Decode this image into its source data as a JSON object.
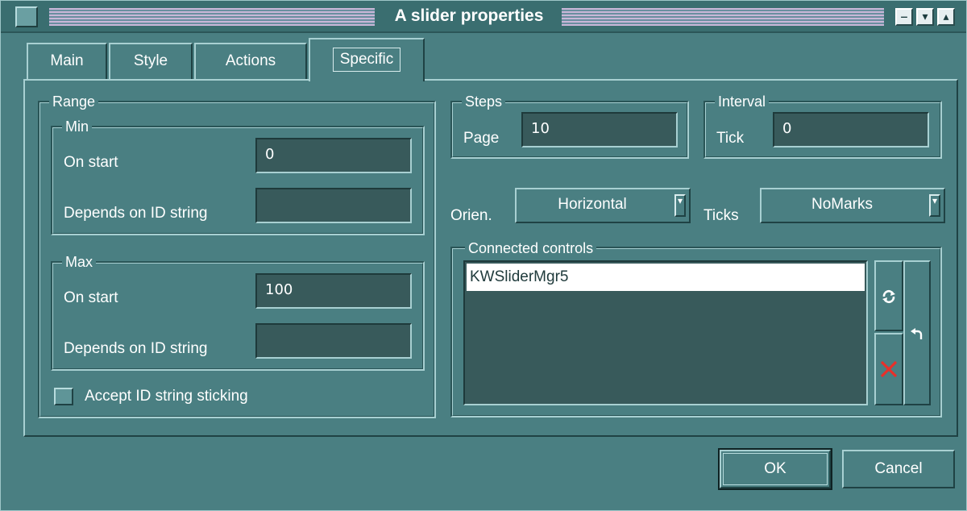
{
  "window": {
    "title": "A slider properties",
    "controls": {
      "minimize": "‒",
      "shade": "▾",
      "maximize": "▴"
    }
  },
  "tabs": [
    {
      "label": "Main",
      "mnemonic": "M"
    },
    {
      "label": "Style",
      "mnemonic": "S"
    },
    {
      "label": "Actions",
      "mnemonic": "A"
    },
    {
      "label": "Specific",
      "mnemonic": "p",
      "active": true
    }
  ],
  "range": {
    "legend": "Range",
    "min": {
      "legend": "Min",
      "on_start_label": "On start",
      "on_start_value": "0",
      "depends_label": "Depends on ID string",
      "depends_value": ""
    },
    "max": {
      "legend": "Max",
      "on_start_label": "On start",
      "on_start_value": "100",
      "depends_label": "Depends on ID string",
      "depends_value": ""
    },
    "accept_sticking_label": "Accept ID string sticking",
    "accept_sticking_checked": false
  },
  "steps": {
    "legend": "Steps",
    "page_label": "Page",
    "page_value": "10"
  },
  "interval": {
    "legend": "Interval",
    "tick_label": "Tick",
    "tick_value": "0"
  },
  "orientation": {
    "label": "Orien.",
    "value": "Horizontal"
  },
  "ticks": {
    "label": "Ticks",
    "value": "NoMarks"
  },
  "connected": {
    "legend": "Connected controls",
    "items": [
      "KWSliderMgr5"
    ],
    "selected": 0
  },
  "buttons": {
    "ok": "OK",
    "cancel": "Cancel"
  },
  "icons": {
    "refresh": "refresh-icon",
    "delete": "delete-icon",
    "undo": "undo-icon"
  },
  "colors": {
    "delete": "#e8302a",
    "background": "#4a7f82"
  }
}
